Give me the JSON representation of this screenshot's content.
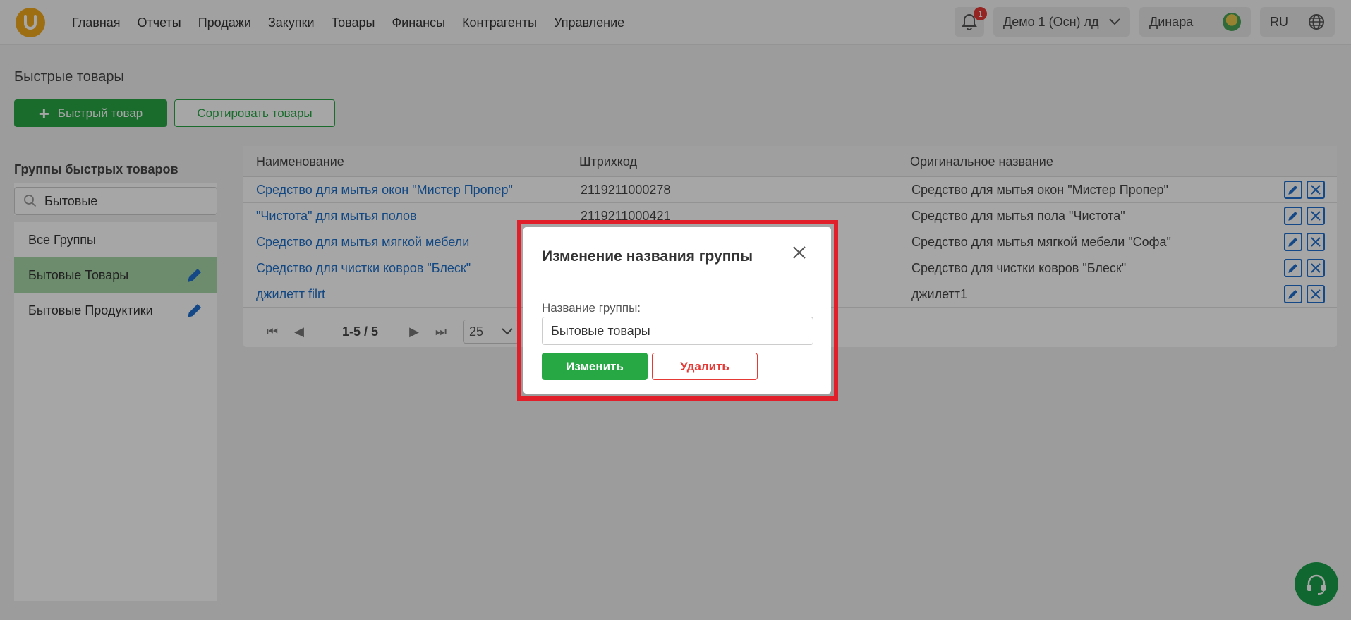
{
  "header": {
    "nav": [
      "Главная",
      "Отчеты",
      "Продажи",
      "Закупки",
      "Товары",
      "Финансы",
      "Контрагенты",
      "Управление"
    ],
    "notification_count": "1",
    "store_select": "Демо 1 (Осн) лд",
    "user_name": "Динара",
    "language": "RU"
  },
  "page": {
    "title": "Быстрые товары",
    "add_button": "Быстрый товар",
    "sort_button": "Сортировать товары"
  },
  "sidebar": {
    "title": "Группы быстрых товаров",
    "search_value": "Бытовые",
    "items": [
      {
        "label": "Все Группы"
      },
      {
        "label": "Бытовые Товары"
      },
      {
        "label": "Бытовые Продуктики"
      }
    ]
  },
  "table": {
    "columns": [
      "Наименование",
      "Штрихкод",
      "Оригинальное название"
    ],
    "rows": [
      {
        "name": "Средство для мытья окон \"Мистер Пропер\"",
        "barcode": "2119211000278",
        "original": "Средство для мытья окон \"Мистер Пропер\""
      },
      {
        "name": "\"Чистота\" для мытья полов",
        "barcode": "2119211000421",
        "original": "Средство для мытья пола \"Чистота\""
      },
      {
        "name": "Средство для мытья мягкой мебели",
        "barcode": "",
        "original": "Средство для мытья мягкой мебели \"Софа\""
      },
      {
        "name": "Средство для чистки ковров \"Блеск\"",
        "barcode": "",
        "original": "Средство для чистки ковров \"Блеск\""
      },
      {
        "name": "джилетт filrt",
        "barcode": "",
        "original": "джилетт1"
      }
    ],
    "pager": {
      "range": "1-5 / 5",
      "page_size": "25"
    }
  },
  "modal": {
    "title": "Изменение названия группы",
    "field_label": "Название группы:",
    "field_value": "Бытовые товары",
    "save_button": "Изменить",
    "delete_button": "Удалить"
  },
  "colors": {
    "accent_green": "#28a745",
    "link_blue": "#1e6fc8",
    "danger_red": "#e53935",
    "highlight_red": "#e01f2a"
  }
}
